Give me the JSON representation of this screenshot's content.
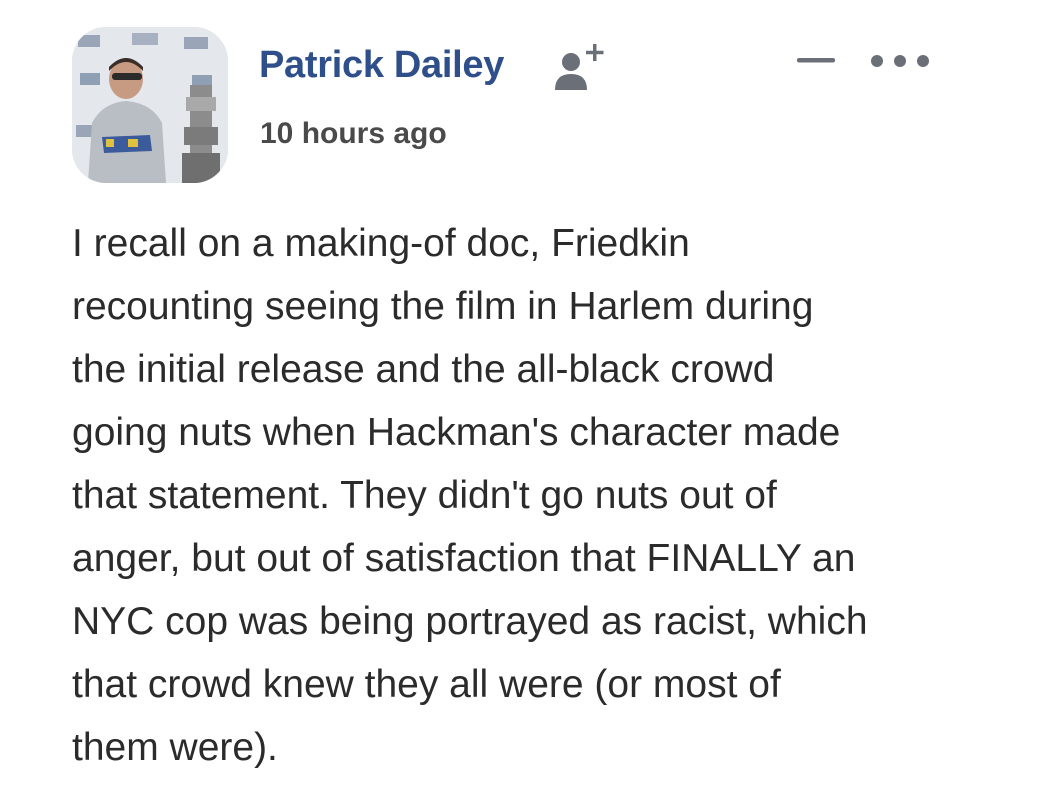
{
  "comment": {
    "author": {
      "name": "Patrick Dailey",
      "avatar": "profile-photo"
    },
    "timestamp": "10 hours ago",
    "icons": {
      "follow": "add-person-icon",
      "collapse": "minus-icon",
      "more": "more-options-icon"
    },
    "colors": {
      "author_name": "#2f4f8a",
      "body_text": "#2b2b2b",
      "icon_gray": "#6b7078"
    },
    "body_lines": [
      "I recall on a making-of doc, Friedkin",
      "recounting seeing the film in Harlem during",
      "the initial release and the all-black crowd",
      "going nuts when Hackman's character made",
      "that statement. They didn't go nuts out of",
      "anger, but out of satisfaction that FINALLY an",
      "NYC cop was being portrayed as racist, which",
      "that crowd knew they all were (or most of",
      "them were)."
    ]
  }
}
